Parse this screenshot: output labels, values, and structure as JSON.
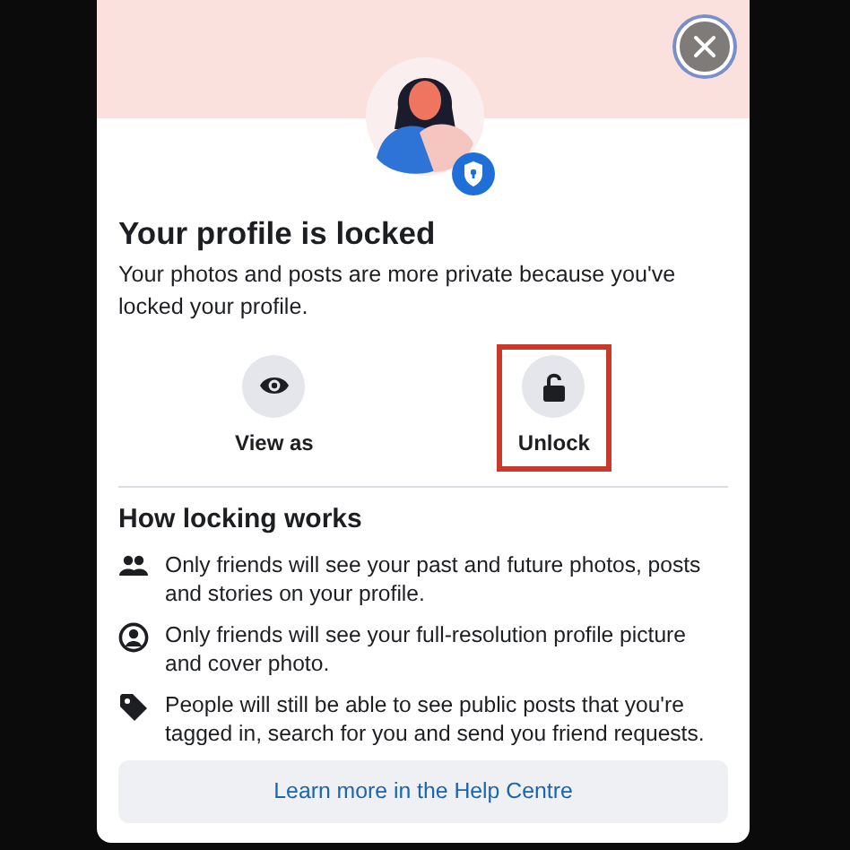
{
  "dialog": {
    "title": "Your profile is locked",
    "description": "Your photos and posts are more private because you've locked your profile.",
    "actions": [
      {
        "label": "View as",
        "highlighted": false
      },
      {
        "label": "Unlock",
        "highlighted": true
      }
    ],
    "section_title": "How locking works",
    "points": [
      "Only friends will see your past and future photos, posts and stories on your profile.",
      "Only friends will see your full-resolution profile picture and cover photo.",
      "People will still be able to see public posts that you're tagged in, search for you and send you friend requests."
    ],
    "help_link": "Learn more in the Help Centre"
  }
}
